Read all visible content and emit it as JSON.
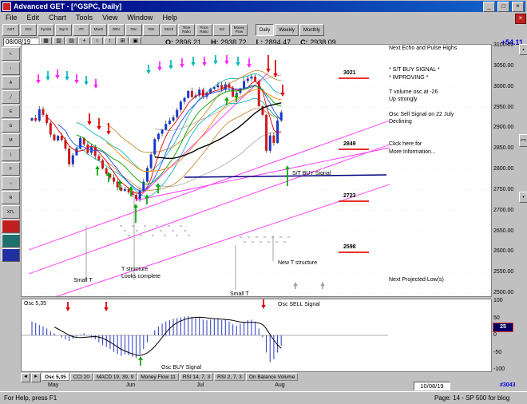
{
  "window": {
    "title": "Advanced GET - [^GSPC, Daily]"
  },
  "titlebar": {
    "minimize": "_",
    "maximize": "□",
    "close": "×",
    "chart_close": "×"
  },
  "menu": {
    "items": [
      "File",
      "Edit",
      "Chart",
      "Tools",
      "View",
      "Window",
      "Help"
    ]
  },
  "toolbar_main": {
    "buttons": [
      "AGT",
      "OCI",
      "Cycles",
      "Sqr 9",
      "JTI",
      "MacD",
      "OBV",
      "Osc",
      "RSI",
      "Stoch",
      "Time Ratio",
      "Price Ratio",
      "Vol",
      "Money Flow"
    ],
    "period": {
      "options": [
        "Daily",
        "Weekly",
        "Monthly"
      ],
      "selected": "Daily"
    }
  },
  "toolbar_chart": {
    "date": "08/08/19",
    "icons": [
      {
        "name": "tile-windows-icon",
        "glyph": "▦"
      },
      {
        "name": "bar-chart-icon",
        "glyph": "▥"
      },
      {
        "name": "candle-chart-icon",
        "glyph": "▤"
      },
      {
        "name": "crosshair-icon",
        "glyph": "+"
      },
      {
        "name": "circle-tool-icon",
        "glyph": "○"
      },
      {
        "name": "expand-icon",
        "glyph": "↕"
      },
      {
        "name": "grid-icon",
        "glyph": "⊞"
      },
      {
        "name": "layout-icon",
        "glyph": "▣"
      }
    ],
    "open_label": "O:",
    "open_value": "2896.21",
    "high_label": "H:",
    "high_value": "2938.72",
    "low_label": "L:",
    "low_value": "2894.47",
    "close_label": "C:",
    "close_value": "2938.09",
    "change": "+54.11"
  },
  "left_toolbar": {
    "tools": [
      {
        "name": "pointer-tool-icon",
        "glyph": "↖"
      },
      {
        "name": "auto-scroll-tool-icon",
        "glyph": "↕"
      },
      {
        "name": "text-tool-icon",
        "glyph": "A"
      },
      {
        "name": "trendline-tool-icon",
        "glyph": "╱"
      },
      {
        "name": "elliott-wave-tool-icon",
        "glyph": "E"
      },
      {
        "name": "gann-tool-icon",
        "glyph": "G"
      },
      {
        "name": "mob-tool-icon",
        "glyph": "M"
      },
      {
        "name": "time-arc-tool-icon",
        "glyph": "("
      },
      {
        "name": "fibonacci-tool-icon",
        "glyph": "F"
      },
      {
        "name": "ellipse-tool-icon",
        "glyph": "○"
      },
      {
        "name": "regression-tool-icon",
        "glyph": "R"
      },
      {
        "name": "xtl-tool-icon",
        "glyph": "XTL"
      },
      {
        "name": "red-swatch",
        "glyph": "",
        "bg": "#c02020"
      },
      {
        "name": "teal-swatch",
        "glyph": "",
        "bg": "#207070"
      },
      {
        "name": "blue-swatch",
        "glyph": "",
        "bg": "#2030a0"
      }
    ]
  },
  "right_toolbar": {
    "up": "▲",
    "pti_label": "PTI",
    "down": "▼"
  },
  "chart": {
    "levels": [
      {
        "label": "3021",
        "price": 3021
      },
      {
        "label": "2849",
        "price": 2849
      },
      {
        "label": "2723",
        "price": 2723
      },
      {
        "label": "2598",
        "price": 2598
      }
    ],
    "annotations": {
      "next_echo": "Next Echo and Pulse Highs",
      "buy_signal": "* S/T BUY SIGNAL *",
      "improving": "* IMPROVING *",
      "t_volume": "T volume osc at -26",
      "up_strongly": "Up strongly",
      "osc_sell": "Osc Sell Signal on 22 July",
      "declining": "Declining",
      "click_here": "Click here for",
      "more_info": "More Information...",
      "st_buy": "S/T BUY Signal",
      "t_structure": "T structure",
      "looks_complete": "Looks complete",
      "new_t": "New T structure",
      "small_t_1": "Small T",
      "small_t_2": "Small T",
      "next_low": "Next Projected Low(s)"
    },
    "price_axis": {
      "ticks": [
        "3100.00",
        "3050.00",
        "3000.00",
        "2950.00",
        "2900.00",
        "2850.00",
        "2800.00",
        "2750.00",
        "2700.00",
        "2650.00",
        "2600.00",
        "2550.00",
        "2500.00"
      ]
    },
    "x_axis": {
      "months": [
        "May",
        "Jun",
        "Jul",
        "Aug"
      ],
      "date_box": "10/08/19",
      "bar_count": "#3043"
    }
  },
  "oscillator": {
    "label": "Osc 5,35",
    "sell_label": "Osc SELL Signal",
    "buy_label": "Osc BUY Signal",
    "axis_ticks": [
      "100",
      "50",
      "0",
      "-50",
      "-100"
    ],
    "current_value": "25"
  },
  "tabs": {
    "prev": "◄",
    "next": "►",
    "items": [
      "Osc 5,35",
      "CCI 20",
      "MACD 19, 39, 9",
      "Money Flow 11",
      "RSI 14, 7, 3",
      "RSI 2, 7, 3",
      "On Balance Volume"
    ],
    "selected": "Osc 5,35"
  },
  "statusbar": {
    "help": "For Help, press F1",
    "page": "Page: 14 - SP 500 for blog"
  },
  "chart_data": {
    "type": "candlestick",
    "symbol": "^GSPC",
    "timeframe": "Daily",
    "price_range": [
      2500,
      3100
    ],
    "osc_range": [
      -100,
      100
    ],
    "month_start_indices": [
      0,
      21,
      40,
      61
    ],
    "closes": [
      2924,
      2918,
      2946,
      2932,
      2912,
      2884,
      2870,
      2881,
      2871,
      2850,
      2812,
      2834,
      2851,
      2876,
      2860,
      2840,
      2854,
      2832,
      2822,
      2802,
      2789,
      2780,
      2770,
      2756,
      2748,
      2752,
      2744,
      2738,
      2728,
      2748,
      2770,
      2803,
      2836,
      2873,
      2886,
      2896,
      2910,
      2918,
      2926,
      2944,
      2964,
      2973,
      2990,
      2975,
      2979,
      2993,
      2976,
      2985,
      2995,
      2999,
      3004,
      2994,
      3006,
      2998,
      2976,
      2985,
      2996,
      3014,
      3020,
      3025,
      3014,
      2953,
      2932,
      2845,
      2882,
      2864,
      2918,
      2938
    ],
    "osc_values": [
      40,
      36,
      30,
      26,
      20,
      12,
      6,
      0,
      -6,
      -12,
      -16,
      -10,
      -4,
      2,
      6,
      0,
      -6,
      -12,
      -20,
      -28,
      -34,
      -40,
      -48,
      -55,
      -60,
      -55,
      -58,
      -62,
      -66,
      -55,
      -40,
      -20,
      0,
      15,
      26,
      34,
      40,
      44,
      48,
      50,
      52,
      55,
      56,
      54,
      50,
      52,
      46,
      44,
      46,
      48,
      50,
      44,
      46,
      40,
      32,
      28,
      34,
      40,
      44,
      46,
      40,
      20,
      -5,
      -50,
      -78,
      -70,
      -50,
      -30
    ]
  }
}
